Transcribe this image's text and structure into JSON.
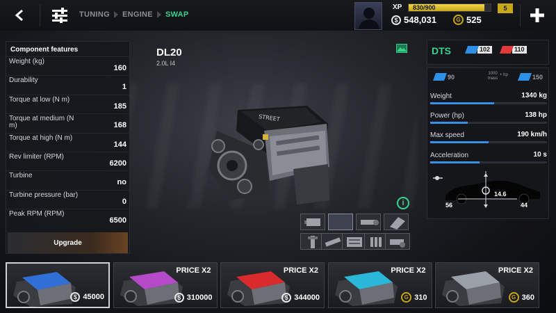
{
  "breadcrumb": [
    "TUNING",
    "ENGINE",
    "SWAP"
  ],
  "player": {
    "xp_label": "XP",
    "xp_text": "830/900",
    "xp_fraction": 0.92,
    "level": "5",
    "money": "548,031",
    "gold": "525"
  },
  "icons": {
    "back": "arrow-left-icon",
    "menu": "sliders-icon",
    "money": "dollar-coin-icon",
    "gold": "gold-coin-icon",
    "plus": "plus-icon",
    "photo": "image-icon",
    "info": "info-icon"
  },
  "features": {
    "title": "Component features",
    "rows": [
      {
        "label": "Weight (kg)",
        "value": "160"
      },
      {
        "label": "Durability",
        "value": "1"
      },
      {
        "label": "Torque at low (N m)",
        "value": "185"
      },
      {
        "label": "Torque at medium (N m)",
        "value": "168"
      },
      {
        "label": "Torque at high (N m)",
        "value": "144"
      },
      {
        "label": "Rev limiter (RPM)",
        "value": "6200"
      },
      {
        "label": "Turbine",
        "value": "no"
      },
      {
        "label": "Turbine pressure (bar)",
        "value": "0"
      },
      {
        "label": "Peak RPM (RPM)",
        "value": "6500"
      }
    ],
    "upgrade_label": "Upgrade"
  },
  "engine": {
    "name": "DL20",
    "subtitle": "2.0L I4"
  },
  "car": {
    "name": "DTS",
    "rating1": "102",
    "rating2": "110",
    "pi_left": "90",
    "pi_mid_line1": "1000",
    "pi_mid_line2": "mass",
    "pi_mid_sub": "+ hp",
    "pi_right": "150",
    "stats": [
      {
        "label": "Weight",
        "value": "1340 kg",
        "fraction": 0.55
      },
      {
        "label": "Power (hp)",
        "value": "138 hp",
        "fraction": 0.32
      },
      {
        "label": "Max speed",
        "value": "190 km/h",
        "fraction": 0.5
      },
      {
        "label": "Acceleration",
        "value": "10 s",
        "fraction": 0.42
      }
    ],
    "weight_front": "56",
    "weight_center": "14.6",
    "weight_rear": "44"
  },
  "cards": [
    {
      "price2": "",
      "currency": "money",
      "price": "45000",
      "color": "#2f6fd6",
      "selected": true
    },
    {
      "price2": "PRICE X2",
      "currency": "money",
      "price": "310000",
      "color": "#b54ac9",
      "selected": false
    },
    {
      "price2": "PRICE X2",
      "currency": "money",
      "price": "344000",
      "color": "#d92b2b",
      "selected": false
    },
    {
      "price2": "PRICE X2",
      "currency": "gold",
      "price": "310",
      "color": "#2bb7d9",
      "selected": false
    },
    {
      "price2": "PRICE X2",
      "currency": "gold",
      "price": "360",
      "color": "#9aa0a8",
      "selected": false
    }
  ],
  "colors": {
    "accent_green": "#39d38e",
    "rating_blue": "#2e8fe6",
    "rating_red": "#e23a3a",
    "xp_gold": "#c9a818"
  }
}
